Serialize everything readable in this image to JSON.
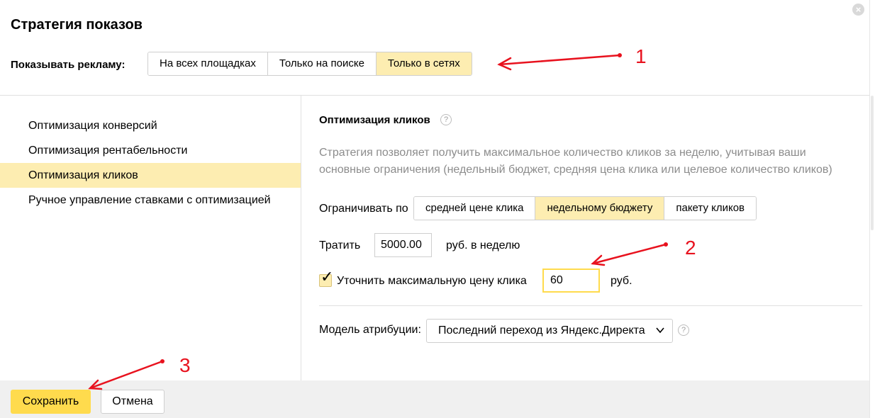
{
  "dialog": {
    "title": "Стратегия показов",
    "close_icon": "close-icon"
  },
  "show_ads": {
    "label": "Показывать рекламу:",
    "options": [
      "На всех площадках",
      "Только на поиске",
      "Только в сетях"
    ],
    "selected": "Только в сетях"
  },
  "sidebar": {
    "items": [
      {
        "label": "Оптимизация конверсий"
      },
      {
        "label": "Оптимизация рентабельности"
      },
      {
        "label": "Оптимизация кликов"
      },
      {
        "label": "Ручное управление ставками с оптимизацией"
      }
    ],
    "selected": "Оптимизация кликов"
  },
  "main": {
    "section_title": "Оптимизация кликов",
    "help_glyph": "?",
    "description": "Стратегия позволяет получить максимальное количество кликов за неделю, учитывая ваши основные ограничения (недельный бюджет, средняя цена клика или целевое количество кликов)",
    "limit": {
      "label": "Ограничивать по",
      "options": [
        "средней цене клика",
        "недельному бюджету",
        "пакету кликов"
      ],
      "selected": "недельному бюджету"
    },
    "spend": {
      "label": "Тратить",
      "value": "5000.00",
      "unit": "руб. в неделю"
    },
    "max_price": {
      "checked": true,
      "check_glyph": "✓",
      "label": "Уточнить максимальную цену клика",
      "value": "60",
      "unit": "руб."
    },
    "attribution": {
      "label": "Модель атрибуции:",
      "selected": "Последний переход из Яндекс.Директа",
      "chevron_icon": "chevron-down-icon"
    }
  },
  "footer": {
    "save_label": "Сохранить",
    "cancel_label": "Отмена"
  },
  "annotations": {
    "numbers": [
      "1",
      "2",
      "3"
    ],
    "color": "#e8121e"
  },
  "colors": {
    "selected_bg": "#fdedb1",
    "primary_button": "#ffdb4d",
    "description_text": "#8c8c8c",
    "footer_bg": "#f0f0f0"
  }
}
